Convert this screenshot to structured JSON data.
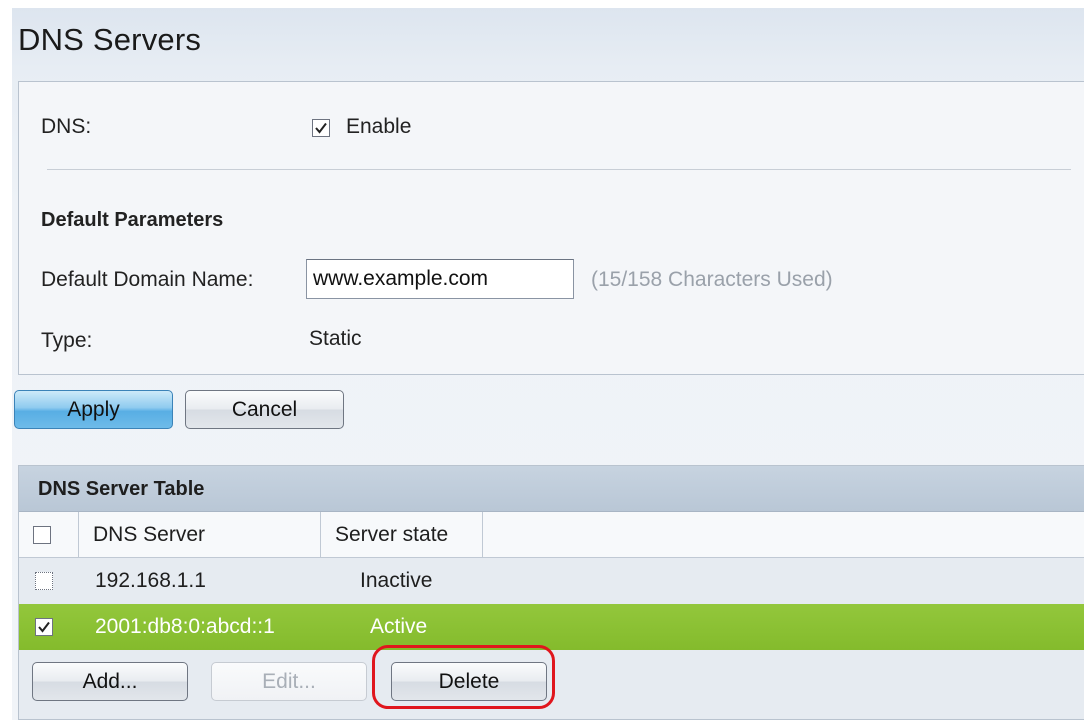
{
  "page": {
    "title": "DNS Servers"
  },
  "settings": {
    "dns_label": "DNS:",
    "dns_enabled": true,
    "enable_label": "Enable",
    "section_heading": "Default Parameters",
    "domain_label": "Default Domain Name:",
    "domain_value": "www.example.com",
    "domain_hint": "(15/158 Characters Used)",
    "type_label": "Type:",
    "type_value": "Static"
  },
  "actions": {
    "apply_label": "Apply",
    "cancel_label": "Cancel"
  },
  "table": {
    "title": "DNS Server Table",
    "columns": [
      "DNS Server",
      "Server state"
    ],
    "rows": [
      {
        "server": "192.168.1.1",
        "state": "Inactive",
        "checked": false,
        "selected": false
      },
      {
        "server": "2001:db8:0:abcd::1",
        "state": "Active",
        "checked": true,
        "selected": true
      }
    ],
    "add_label": "Add...",
    "edit_label": "Edit...",
    "delete_label": "Delete"
  },
  "colors": {
    "selected_row": "#8dc135",
    "primary_button": "#6ebbe9",
    "highlight_ring": "#e0161d"
  }
}
